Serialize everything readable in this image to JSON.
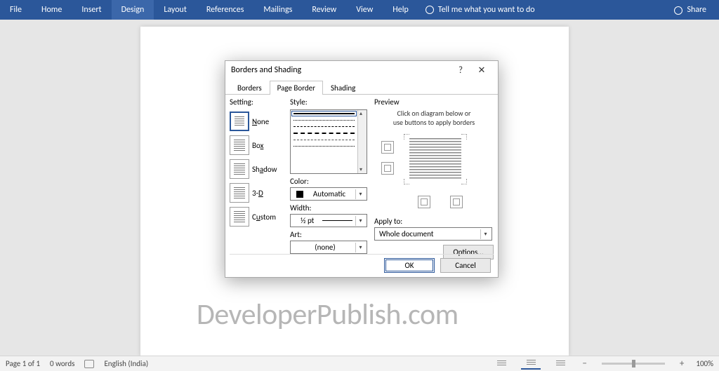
{
  "ribbon": {
    "tabs": [
      "File",
      "Home",
      "Insert",
      "Design",
      "Layout",
      "References",
      "Mailings",
      "Review",
      "View",
      "Help"
    ],
    "tell_me": "Tell me what you want to do",
    "share": "Share"
  },
  "watermark": "DeveloperPublish.com",
  "dialog": {
    "title": "Borders and Shading",
    "tabs": {
      "borders": "Borders",
      "page_border": "Page Border",
      "shading": "Shading",
      "active": "page_border"
    },
    "setting": {
      "label": "Setting:",
      "items": {
        "none": "None",
        "box": "Box",
        "shadow": "Shadow",
        "threeD": "3-D",
        "custom": "Custom"
      },
      "selected": "none"
    },
    "style": {
      "label": "Style:",
      "color_label": "Color:",
      "color_value": "Automatic",
      "width_label": "Width:",
      "width_value": "½ pt",
      "art_label": "Art:",
      "art_value": "(none)"
    },
    "preview": {
      "label": "Preview",
      "hint_line1": "Click on diagram below or",
      "hint_line2": "use buttons to apply borders",
      "apply_label": "Apply to:",
      "apply_value": "Whole document",
      "options": "Options..."
    },
    "buttons": {
      "ok": "OK",
      "cancel": "Cancel"
    }
  },
  "status": {
    "page": "Page 1 of 1",
    "words": "0 words",
    "lang": "English (India)",
    "zoom": "100%"
  }
}
